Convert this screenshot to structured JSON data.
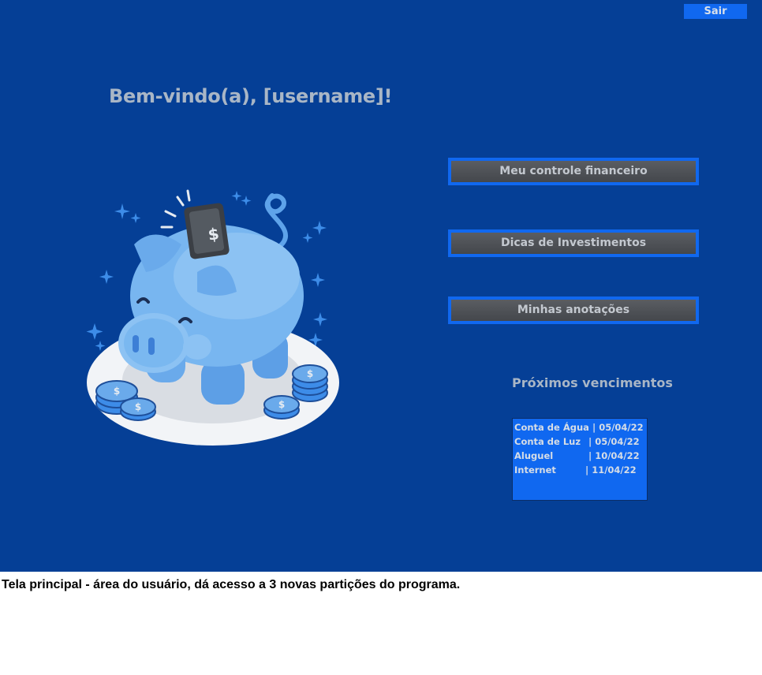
{
  "header": {
    "exit_label": "Sair"
  },
  "welcome": {
    "text": "Bem-vindo(a), [username]!"
  },
  "menu": {
    "items": [
      {
        "label": "Meu controle financeiro"
      },
      {
        "label": "Dicas de Investimentos"
      },
      {
        "label": "Minhas anotações"
      }
    ]
  },
  "due": {
    "title": "Próximos vencimentos",
    "rows": [
      {
        "name": "Conta de Água",
        "date": "| 05/04/22"
      },
      {
        "name": "Conta de Luz",
        "date": "| 05/04/22"
      },
      {
        "name": "Aluguel",
        "date": "| 10/04/22"
      },
      {
        "name": "Internet",
        "date": "| 11/04/22"
      }
    ]
  },
  "caption": {
    "text": "Tela principal - área do usuário, dá acesso a 3 novas partições do programa."
  },
  "illustration": {
    "icon": "piggy-bank-icon",
    "coin_symbol": "$"
  },
  "colors": {
    "background": "#053f96",
    "accent": "#1068f0",
    "button_face": "#4e5156",
    "text_light": "#a9b6c6",
    "pig": "#6fb0ee"
  }
}
